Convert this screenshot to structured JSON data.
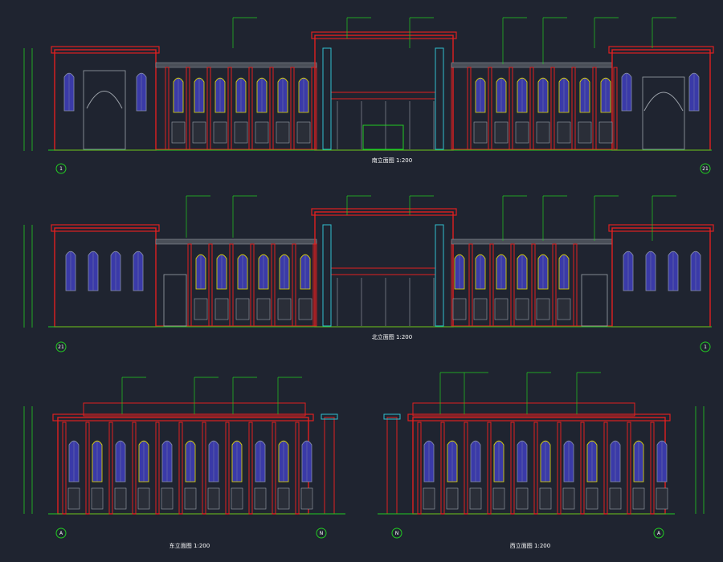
{
  "palette": {
    "background": "#1f2430",
    "outline": "#e02020",
    "window": "#3a3aa8",
    "arch_glow": "#e8e000",
    "leader": "#22cc22",
    "accent": "#30c0d0",
    "detail": "#9aa0a8"
  },
  "elevations": [
    {
      "id": "south",
      "caption": "南立面图 1:200",
      "grid_left": "1",
      "grid_right": "21"
    },
    {
      "id": "north",
      "caption": "北立面图 1:200",
      "grid_left": "21",
      "grid_right": "1"
    },
    {
      "id": "east",
      "caption": "东立面图 1:200",
      "grid_left": "A",
      "grid_right": "N"
    },
    {
      "id": "west",
      "caption": "西立面图 1:200",
      "grid_left": "N",
      "grid_right": "A"
    }
  ]
}
